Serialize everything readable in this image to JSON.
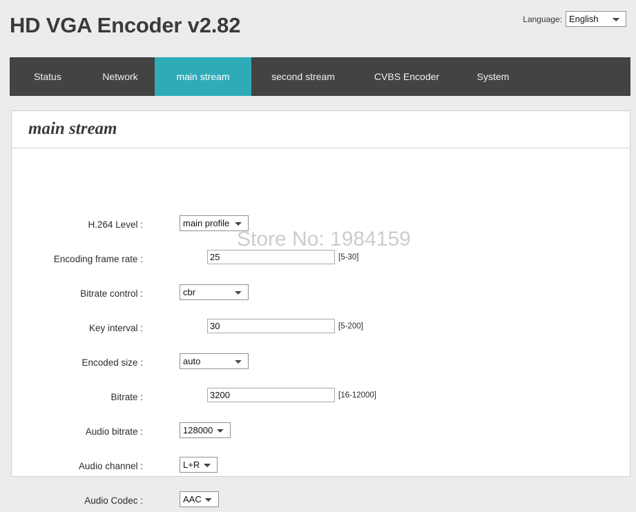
{
  "header": {
    "app_title": "HD VGA Encoder v2.82",
    "language_label": "Language:",
    "language_value": "English",
    "language_options": [
      "English"
    ]
  },
  "nav": {
    "items": [
      {
        "label": "Status",
        "active": false
      },
      {
        "label": "Network",
        "active": false
      },
      {
        "label": "main stream",
        "active": true
      },
      {
        "label": "second stream",
        "active": false
      },
      {
        "label": "CVBS Encoder",
        "active": false
      },
      {
        "label": "System",
        "active": false
      }
    ]
  },
  "panel": {
    "title": "main stream"
  },
  "form": {
    "rows": [
      {
        "label": "H.264 Level :",
        "type": "select",
        "value": "main profile",
        "hint": ""
      },
      {
        "label": "Encoding frame rate :",
        "type": "text",
        "value": "25",
        "hint": "[5-30]"
      },
      {
        "label": "Bitrate control :",
        "type": "select",
        "value": "cbr",
        "hint": ""
      },
      {
        "label": "Key interval :",
        "type": "text",
        "value": "30",
        "hint": "[5-200]"
      },
      {
        "label": "Encoded size :",
        "type": "select",
        "value": "auto",
        "hint": ""
      },
      {
        "label": "Bitrate :",
        "type": "text",
        "value": "3200",
        "hint": "[16-12000]"
      },
      {
        "label": "Audio bitrate :",
        "type": "select",
        "value": "128000",
        "hint": ""
      },
      {
        "label": "Audio channel :",
        "type": "select",
        "value": "L+R",
        "hint": ""
      },
      {
        "label": "Audio Codec :",
        "type": "select",
        "value": "AAC",
        "hint": ""
      }
    ]
  },
  "watermark": {
    "text": "Store No: 1984159"
  },
  "colors": {
    "page_background": "#ececec",
    "nav_background": "#434343",
    "nav_active": "#2fabb8",
    "panel_background": "#ffffff",
    "panel_border": "#cfcfcf",
    "text": "#2b2b2b",
    "watermark": "#cccccc"
  }
}
